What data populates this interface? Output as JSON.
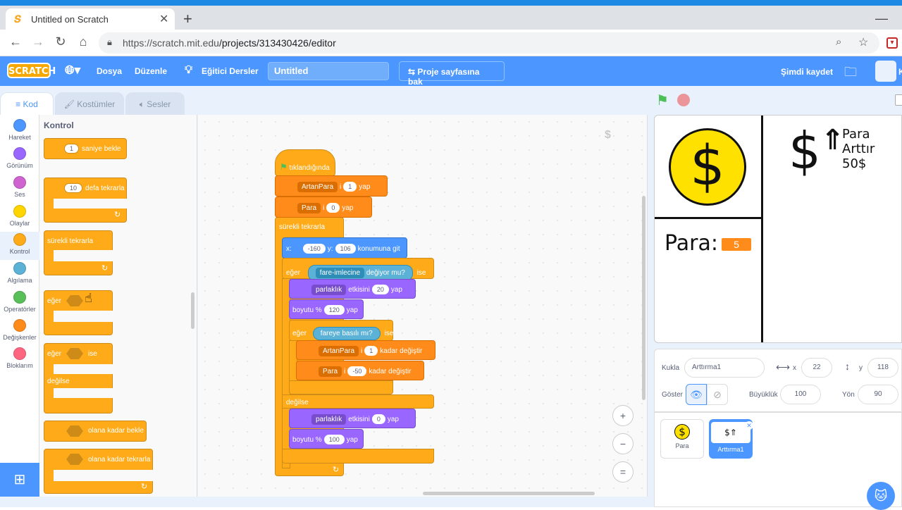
{
  "browser": {
    "tab_title": "Untitled on Scratch",
    "tab_close": "✕",
    "new_tab": "+",
    "minimize": "—",
    "url_host": "https://scratch.mit.edu",
    "url_path": "/projects/313430426/editor"
  },
  "menubar": {
    "logo": "SCRATCH",
    "file": "Dosya",
    "edit": "Düzenle",
    "tutorials": "Eğitici Dersler",
    "project_title": "Untitled",
    "see_project_page": "Proje sayfasına bak",
    "save_now": "Şimdi kaydet",
    "user_initial": "K"
  },
  "tabs": {
    "code": "Kod",
    "costumes": "Kostümler",
    "sounds": "Sesler"
  },
  "categories": [
    {
      "label": "Hareket",
      "color": "#4c97ff"
    },
    {
      "label": "Görünüm",
      "color": "#9966ff"
    },
    {
      "label": "Ses",
      "color": "#cf63cf"
    },
    {
      "label": "Olaylar",
      "color": "#ffd500"
    },
    {
      "label": "Kontrol",
      "color": "#ffab19"
    },
    {
      "label": "Algılama",
      "color": "#5cb1d6"
    },
    {
      "label": "Operatörler",
      "color": "#59c059"
    },
    {
      "label": "Değişkenler",
      "color": "#ff8c1a"
    },
    {
      "label": "Bloklarım",
      "color": "#ff6680"
    }
  ],
  "palette": {
    "title": "Kontrol",
    "wait_value": "1",
    "wait_label": "saniye bekle",
    "repeat_value": "10",
    "repeat_label": "defa tekrarla",
    "forever_label": "sürekli tekrarla",
    "if_label": "eğer",
    "if_then_label": "ise",
    "if_else_if": "eğer",
    "if_else_then": "ise",
    "if_else_else": "değilse",
    "wait_until_label": "olana kadar bekle",
    "repeat_until_label": "olana kadar tekrarla"
  },
  "script": {
    "hat": "tıklandığında",
    "set1_var": "ArtanPara",
    "set1_to": "i",
    "set1_val": "1",
    "set1_end": "yap",
    "set2_var": "Para",
    "set2_to": "i",
    "set2_val": "0",
    "set2_end": "yap",
    "forever": "sürekli tekrarla",
    "goto_x_label": "x:",
    "goto_x": "-160",
    "goto_y_label": "y:",
    "goto_y": "106",
    "goto_end": "konumuna git",
    "if1": "eğer",
    "if1_touch": "fare-imlecine",
    "if1_touching": "değiyor mu?",
    "if1_then": "ise",
    "eff1_name": "parlaklık",
    "eff1_label": "etkisini",
    "eff1_val": "20",
    "eff1_end": "yap",
    "size1_label": "boyutu %",
    "size1_val": "120",
    "size1_end": "yap",
    "if2": "eğer",
    "if2_cond": "fareye basılı mı?",
    "if2_then": "ise",
    "chg1_var": "ArtanPara",
    "chg1_to": "i",
    "chg1_val": "1",
    "chg1_end": "kadar değiştir",
    "chg2_var": "Para",
    "chg2_to": "i",
    "chg2_val": "-50",
    "chg2_end": "kadar değiştir",
    "else": "değilse",
    "eff2_name": "parlaklık",
    "eff2_label": "etkisini",
    "eff2_val": "0",
    "eff2_end": "yap",
    "size2_label": "boyutu %",
    "size2_val": "100",
    "size2_end": "yap"
  },
  "zoom": {
    "in": "+",
    "out": "−",
    "reset": "="
  },
  "stage": {
    "para_label": "Para:",
    "para_value": "5",
    "coin_symbol": "$",
    "artirma_title": "Para Arttır",
    "artirma_price": "50$",
    "artirma_symbol": "$"
  },
  "sprite_info": {
    "sprite_label": "Kukla",
    "sprite_name": "Arttırma1",
    "x_label": "x",
    "x_value": "22",
    "y_label": "y",
    "y_value": "118",
    "show_label": "Göster",
    "size_label": "Büyüklük",
    "size_value": "100",
    "direction_label": "Yön",
    "direction_value": "90"
  },
  "sprites": [
    {
      "name": "Para"
    },
    {
      "name": "Arttırma1"
    }
  ]
}
